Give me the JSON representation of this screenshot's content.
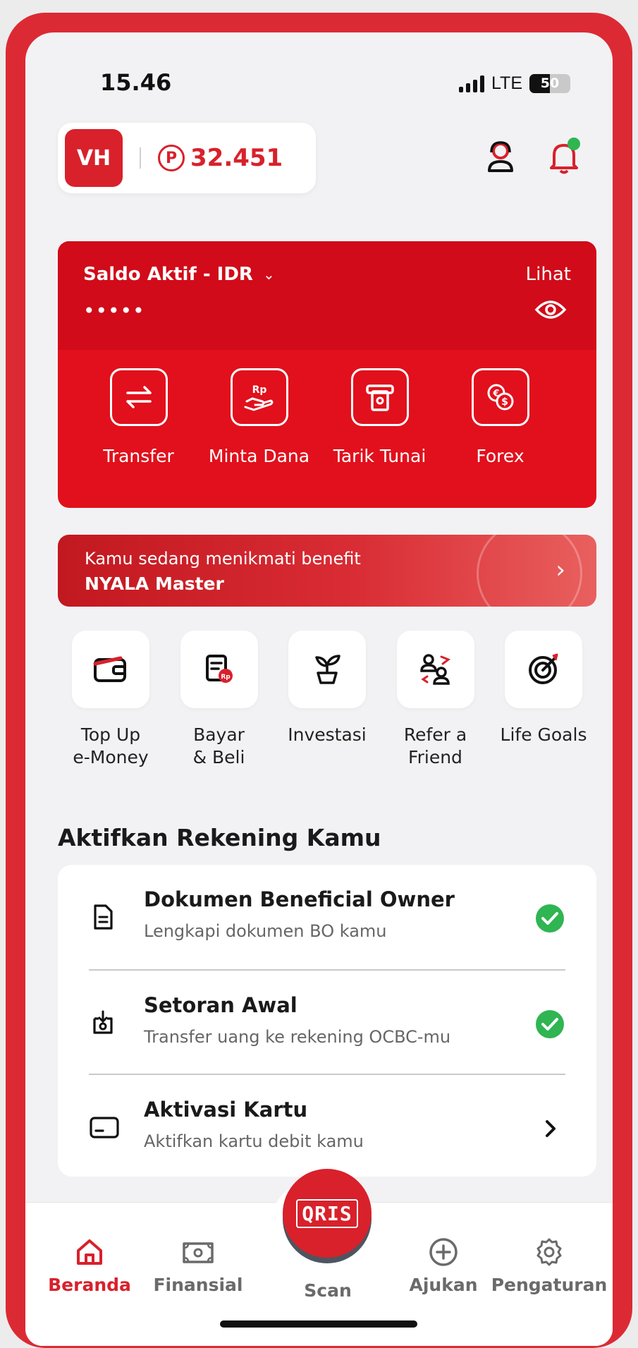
{
  "status_bar": {
    "time": "15.46",
    "network": "LTE",
    "battery": "50"
  },
  "header": {
    "avatar_initials": "VH",
    "points_symbol": "P",
    "points": "32.451"
  },
  "balance": {
    "label": "Saldo Aktif - IDR",
    "hidden_value": "•••••",
    "view_label": "Lihat"
  },
  "actions": [
    {
      "label": "Transfer",
      "icon": "transfer-icon"
    },
    {
      "label": "Minta Dana",
      "icon": "request-money-icon"
    },
    {
      "label": "Tarik Tunai",
      "icon": "cash-withdraw-icon"
    },
    {
      "label": "Forex",
      "icon": "forex-icon"
    }
  ],
  "benefit": {
    "line1": "Kamu sedang menikmati benefit",
    "line2": "NYALA Master"
  },
  "shortcuts": [
    {
      "label": "Top Up\ne-Money",
      "icon": "wallet-icon"
    },
    {
      "label": "Bayar\n& Beli",
      "icon": "bill-icon"
    },
    {
      "label": "Investasi",
      "icon": "plant-icon"
    },
    {
      "label": "Refer a\nFriend",
      "icon": "refer-icon"
    },
    {
      "label": "Life Goals",
      "icon": "target-icon"
    }
  ],
  "activation": {
    "title": "Aktifkan Rekening Kamu",
    "items": [
      {
        "title": "Dokumen Beneficial Owner",
        "subtitle": "Lengkapi dokumen BO kamu",
        "status": "done"
      },
      {
        "title": "Setoran Awal",
        "subtitle": "Transfer uang ke rekening OCBC-mu",
        "status": "done"
      },
      {
        "title": "Aktivasi Kartu",
        "subtitle": "Aktifkan kartu debit kamu",
        "status": "pending"
      }
    ]
  },
  "nav": {
    "items": [
      "Beranda",
      "Finansial",
      "Scan",
      "Ajukan",
      "Pengaturan"
    ],
    "scan_logo": "QRIS",
    "active": "Beranda"
  },
  "colors": {
    "brand_red": "#d8212b",
    "success_green": "#2fb552"
  }
}
